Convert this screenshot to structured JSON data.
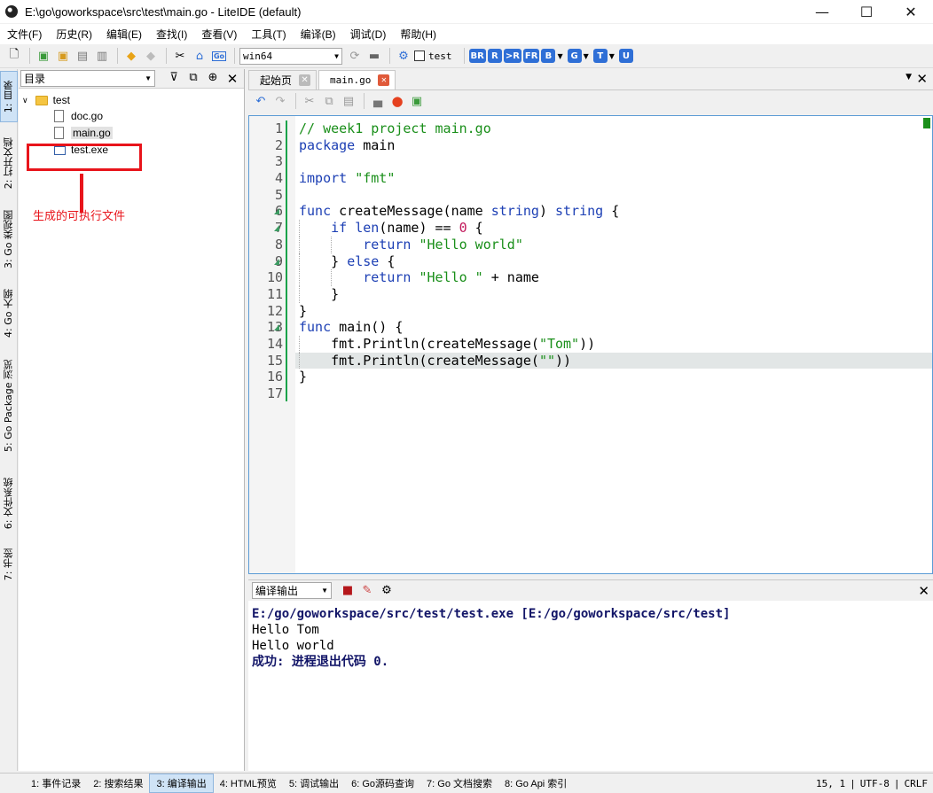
{
  "window": {
    "title": "E:\\go\\goworkspace\\src\\test\\main.go - LiteIDE (default)",
    "min": "—",
    "max": "☐",
    "close": "✕"
  },
  "menu": [
    "文件(F)",
    "历史(R)",
    "编辑(E)",
    "查找(I)",
    "查看(V)",
    "工具(T)",
    "编译(B)",
    "调试(D)",
    "帮助(H)"
  ],
  "toolbar": {
    "env": "win64",
    "target_label": "test",
    "build_badges": [
      "BR",
      "R",
      ">R",
      "FR",
      "B",
      "G",
      "T",
      "U"
    ]
  },
  "sidebar_tabs": [
    "1: 目录",
    "2: 打开文档",
    "3: Go 类视图",
    "4: Go 大纲",
    "5: Go Package 浏览",
    "6: 文件系统",
    "7: 书签"
  ],
  "tree": {
    "header": "目录",
    "items": [
      {
        "name": "test",
        "type": "folder"
      },
      {
        "name": "doc.go",
        "type": "file"
      },
      {
        "name": "main.go",
        "type": "file"
      },
      {
        "name": "test.exe",
        "type": "exe"
      }
    ],
    "annotation": "生成的可执行文件"
  },
  "editor": {
    "tabs": [
      {
        "label": "起始页"
      },
      {
        "label": "main.go"
      }
    ],
    "current_line": 15,
    "lines": [
      "// week1 project main.go",
      "package main",
      "",
      "import \"fmt\"",
      "",
      "func createMessage(name string) string {",
      "    if len(name) == 0 {",
      "        return \"Hello world\"",
      "    } else {",
      "        return \"Hello \" + name",
      "    }",
      "}",
      "func main() {",
      "    fmt.Println(createMessage(\"Tom\"))",
      "    fmt.Println(createMessage(\"\"))",
      "}",
      ""
    ]
  },
  "output": {
    "selector": "编译输出",
    "lines": [
      "E:/go/goworkspace/src/test/test.exe  [E:/go/goworkspace/src/test]",
      "Hello Tom",
      "Hello world",
      "成功: 进程退出代码 0."
    ]
  },
  "statusbar": {
    "tabs": [
      "1: 事件记录",
      "2: 搜索结果",
      "3: 编译输出",
      "4: HTML预览",
      "5: 调试输出",
      "6: Go源码查询",
      "7: Go 文档搜索",
      "8: Go Api 索引"
    ],
    "position": "15,   1",
    "encoding": "UTF-8",
    "line_ending": "CRLF"
  }
}
